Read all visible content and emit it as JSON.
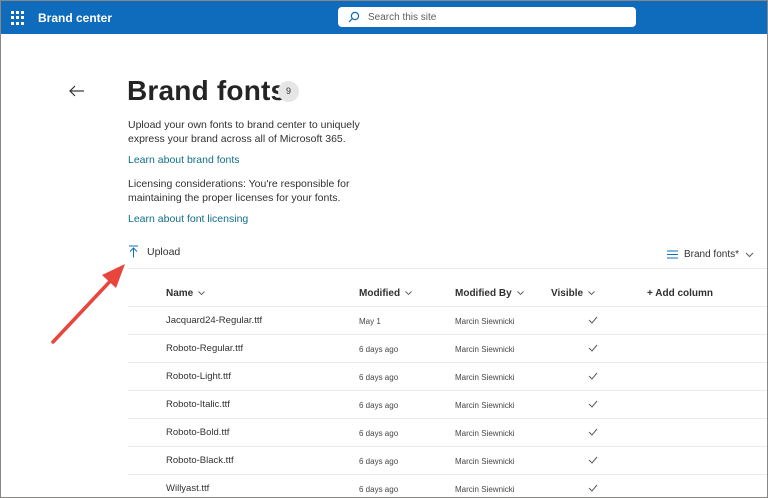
{
  "suite_bar": {
    "app_name": "Brand center",
    "search_placeholder": "Search this site"
  },
  "page": {
    "title": "Brand fonts",
    "count": "9",
    "description": "Upload your own fonts to brand center to uniquely express your brand across all of Microsoft 365.",
    "learn_link": "Learn about brand fonts",
    "licensing_text": "Licensing considerations: You're responsible for maintaining the proper licenses for your fonts.",
    "licensing_link": "Learn about font licensing"
  },
  "toolbar": {
    "upload_label": "Upload",
    "view_label": "Brand fonts*"
  },
  "table": {
    "columns": {
      "name": "Name",
      "modified": "Modified",
      "modified_by": "Modified By",
      "visible": "Visible",
      "add_column": "+ Add column"
    },
    "rows": [
      {
        "name": "Jacquard24-Regular.ttf",
        "modified": "May 1",
        "modified_by": "Marcin Siewnicki",
        "visible": true
      },
      {
        "name": "Roboto-Regular.ttf",
        "modified": "6 days ago",
        "modified_by": "Marcin Siewnicki",
        "visible": true
      },
      {
        "name": "Roboto-Light.ttf",
        "modified": "6 days ago",
        "modified_by": "Marcin Siewnicki",
        "visible": true
      },
      {
        "name": "Roboto-Italic.ttf",
        "modified": "6 days ago",
        "modified_by": "Marcin Siewnicki",
        "visible": true
      },
      {
        "name": "Roboto-Bold.ttf",
        "modified": "6 days ago",
        "modified_by": "Marcin Siewnicki",
        "visible": true
      },
      {
        "name": "Roboto-Black.ttf",
        "modified": "6 days ago",
        "modified_by": "Marcin Siewnicki",
        "visible": true
      },
      {
        "name": "Willyast.ttf",
        "modified": "6 days ago",
        "modified_by": "Marcin Siewnicki",
        "visible": true
      }
    ]
  },
  "colors": {
    "suite_bar": "#0f6cbd",
    "link": "#0f6e8a",
    "annotation_arrow": "#e8453c"
  }
}
